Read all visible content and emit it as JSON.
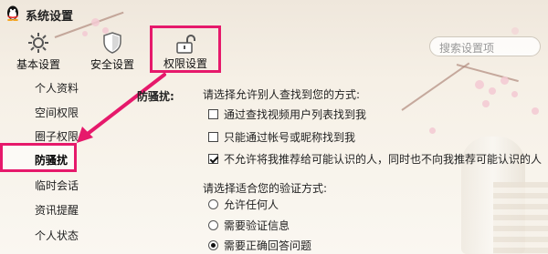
{
  "window": {
    "title": "系统设置"
  },
  "toolbar": {
    "basic_label": "基本设置",
    "security_label": "安全设置",
    "permission_label": "权限设置",
    "search_placeholder": "搜索设置项"
  },
  "sidebar": {
    "items": [
      {
        "label": "个人资料"
      },
      {
        "label": "空间权限"
      },
      {
        "label": "圈子权限"
      },
      {
        "label": "防骚扰",
        "active": true
      },
      {
        "label": "临时会话"
      },
      {
        "label": "资讯提醒"
      },
      {
        "label": "个人状态"
      }
    ]
  },
  "content": {
    "section_title": "防骚扰:",
    "find_prompt": "请选择允许别人查找到您的方式:",
    "find_options": [
      {
        "label": "通过查找视频用户列表找到我",
        "checked": false
      },
      {
        "label": "只能通过帐号或昵称找到我",
        "checked": false
      },
      {
        "label": "不允许将我推荐给可能认识的人，同时也不向我推荐可能认识的人",
        "checked": true
      }
    ],
    "verify_prompt": "请选择适合您的验证方式:",
    "verify_options": [
      {
        "label": "允许任何人",
        "selected": false
      },
      {
        "label": "需要验证信息",
        "selected": false
      },
      {
        "label": "需要正确回答问题",
        "selected": true
      }
    ]
  },
  "colors": {
    "highlight": "#e6196b",
    "background": "#f7f2ea"
  },
  "icons": {
    "app": "qq-penguin-icon",
    "basic": "gear-icon",
    "security": "shield-icon",
    "permission": "unlock-icon",
    "annotation": "arrow-annotation"
  }
}
